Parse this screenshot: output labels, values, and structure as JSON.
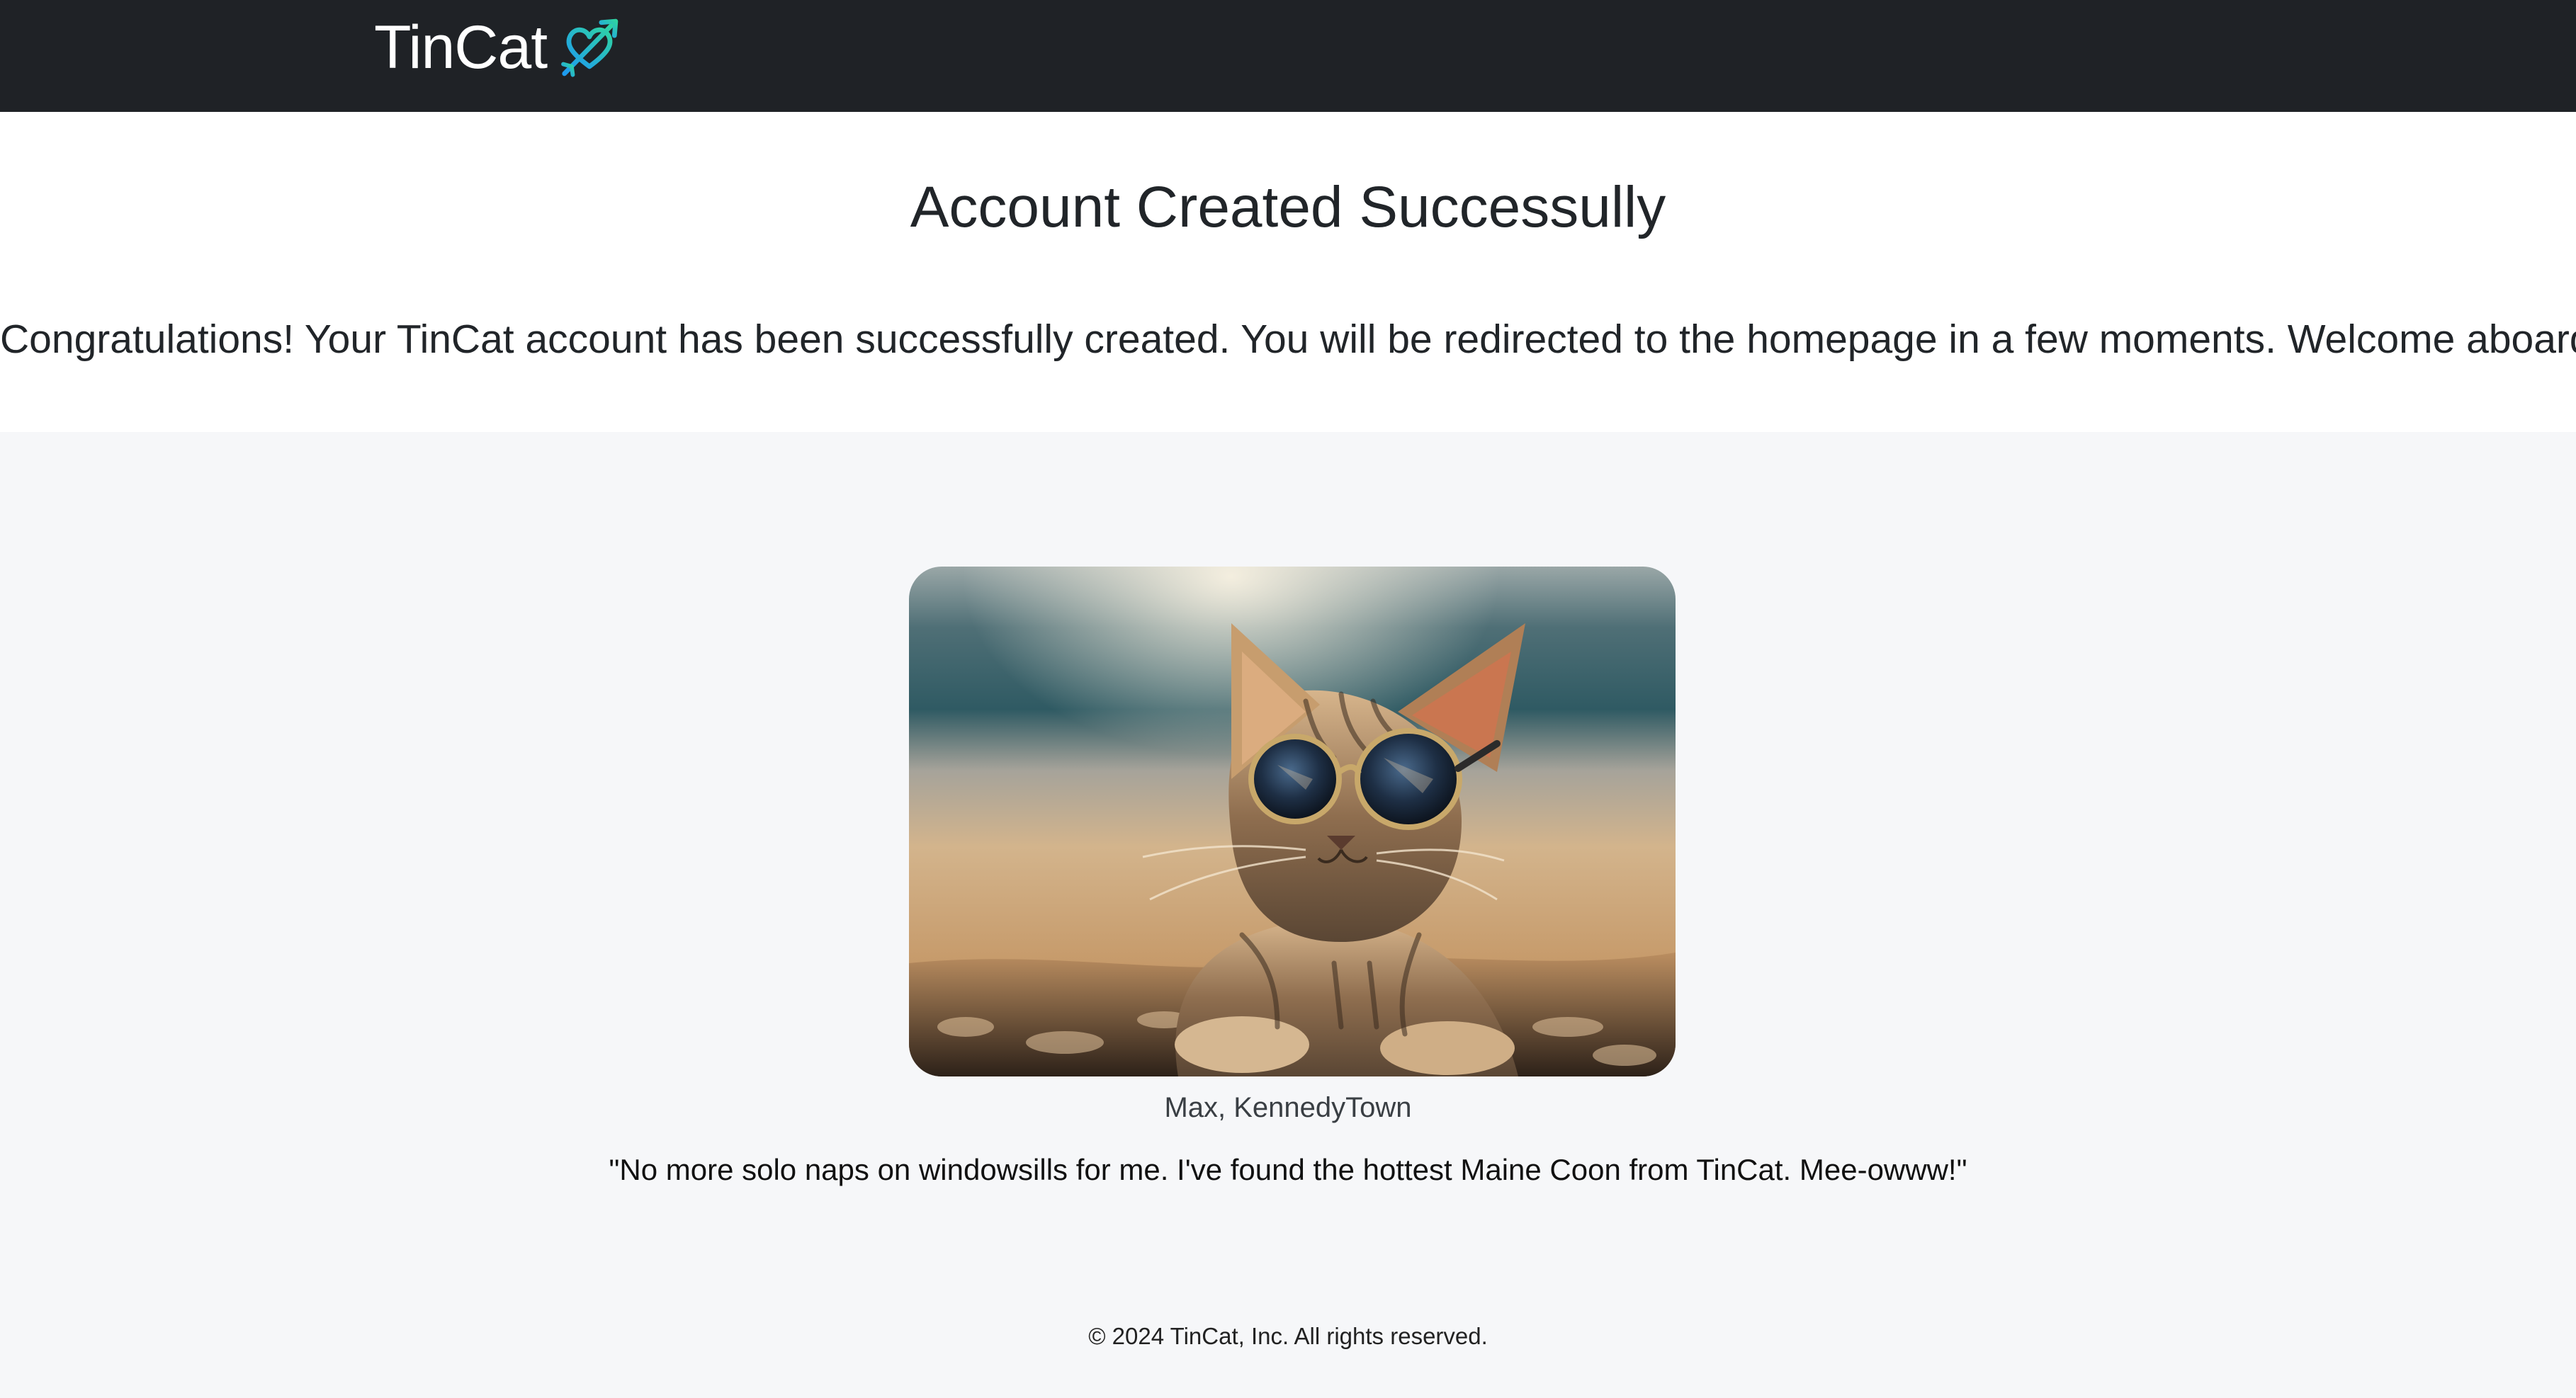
{
  "navbar": {
    "brand_name": "TinCat",
    "logo_icon": "heart-arrow-icon",
    "logo_color": "#2fd3a3"
  },
  "hero": {
    "title": "Account Created Successully",
    "message": "Congratulations! Your TinCat account has been successfully created. You will be redirected to the homepage in a few moments. Welcome aboard!"
  },
  "testimonial": {
    "image_icon": "cat-with-sunglasses-photo",
    "name": "Max, KennedyTown",
    "quote": "\"No more solo naps on windowsills for me. I've found the hottest Maine Coon from TinCat. Mee-owww!\""
  },
  "footer": {
    "copyright": "© 2024 TinCat, Inc. All rights reserved."
  },
  "colors": {
    "navbar_bg": "#1f2226",
    "page_bg": "#f6f7f9",
    "hero_bg": "#ffffff",
    "text": "#212529"
  }
}
